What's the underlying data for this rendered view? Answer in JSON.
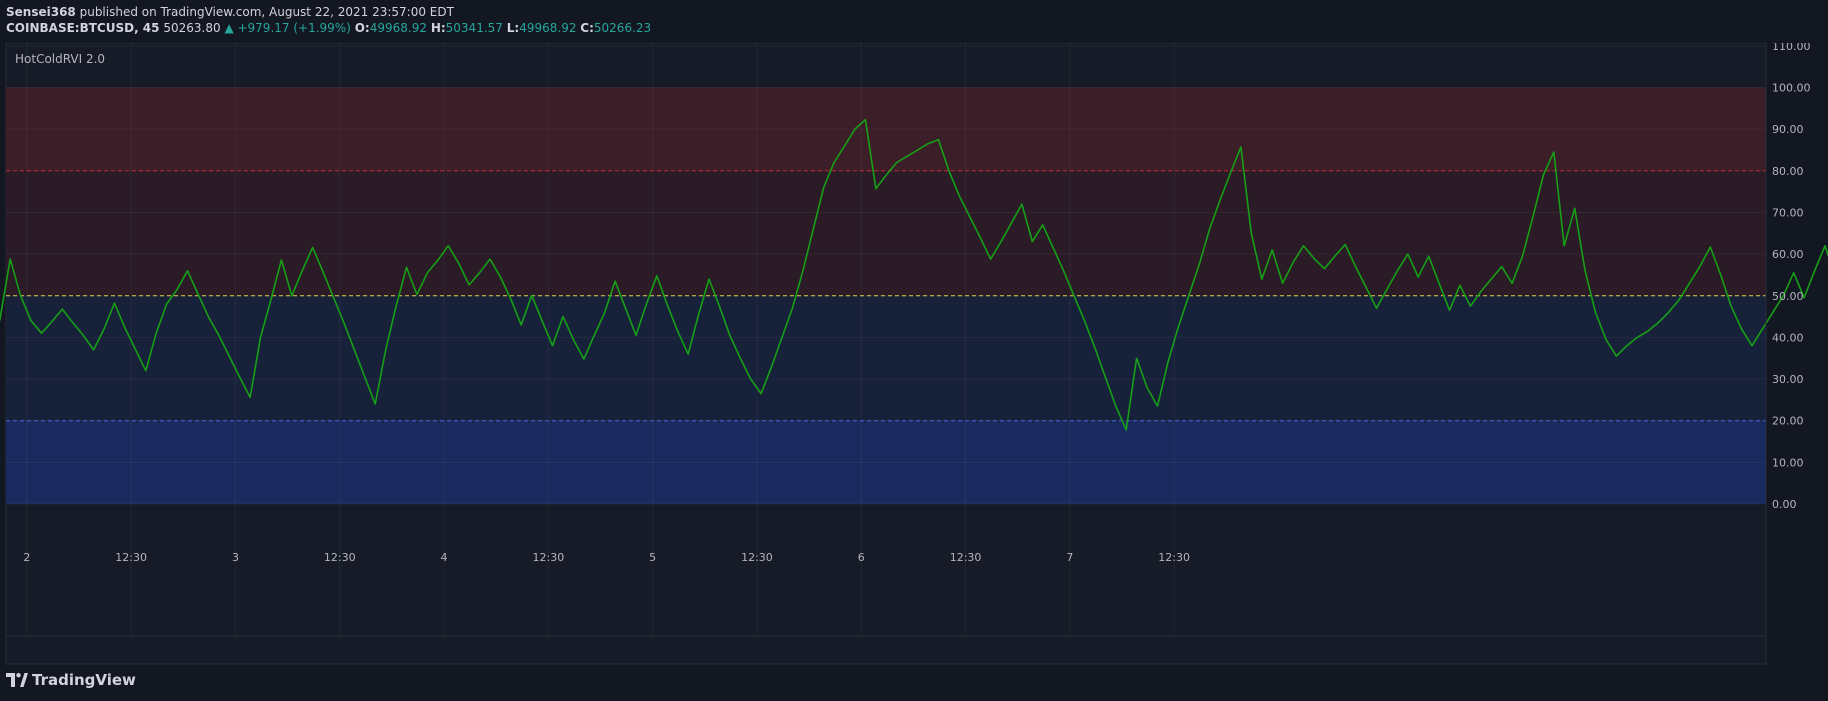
{
  "header": {
    "author": "Sensei368",
    "published": " published on TradingView.com, August 22, 2021 23:57:00 EDT",
    "symbol": "COINBASE:BTCUSD, 45",
    "last": "50263.80",
    "change": "▲ +979.17 (+1.99%)",
    "o_label": "O:",
    "o_val": "49968.92",
    "h_label": "H:",
    "h_val": "50341.57",
    "l_label": "L:",
    "l_val": "49968.92",
    "c_label": "C:",
    "c_val": "50266.23"
  },
  "brand": {
    "name": "TradingView",
    "icon": "tradingview-logo-icon"
  },
  "colors": {
    "background": "#131722",
    "line": "#15a015",
    "hot_zone": "#3b1e27",
    "warm_zone": "#2a1b26",
    "cool_zone": "#18213a",
    "cold_zone": "#1a2a5e",
    "hot_line": "#c62828",
    "cold_line": "#3d6ad6",
    "mid_line": "#e0d24a"
  },
  "chart_data": {
    "type": "line",
    "title": "HotColdRVI 2.0",
    "ylim": [
      0,
      110
    ],
    "y_ticks": [
      "0.00",
      "10.00",
      "20.00",
      "30.00",
      "40.00",
      "50.00",
      "60.00",
      "70.00",
      "80.00",
      "90.00",
      "100.00",
      "110.00"
    ],
    "x_tick_labels": [
      "2",
      "12:30",
      "3",
      "12:30",
      "4",
      "12:30",
      "5",
      "12:30",
      "6",
      "12:30",
      "7",
      "12:30"
    ],
    "x_tick_index": [
      2,
      12,
      22,
      32,
      42,
      52,
      62,
      72,
      82,
      92,
      102,
      112
    ],
    "bands": [
      {
        "from": 80,
        "to": 100,
        "name": "hot"
      },
      {
        "from": 50,
        "to": 80,
        "name": "warm"
      },
      {
        "from": 20,
        "to": 50,
        "name": "cool"
      },
      {
        "from": 0,
        "to": 20,
        "name": "cold"
      }
    ],
    "levels": [
      {
        "value": 80,
        "style": "dashed",
        "name": "hot"
      },
      {
        "value": 50,
        "style": "dashed",
        "name": "mid"
      },
      {
        "value": 20,
        "style": "dashed",
        "name": "cold"
      }
    ],
    "grid": true,
    "series": [
      {
        "x_start": -0.6,
        "values": [
          44,
          58.8,
          50,
          44,
          41,
          43.8,
          46.8,
          43.5,
          40.5,
          37,
          42,
          48.2,
          42.3,
          37.2,
          32,
          41,
          48,
          51.5,
          56,
          50.5,
          45,
          40.5,
          35.5,
          30.5,
          25.6,
          40,
          49,
          58.6,
          50,
          56,
          61.6,
          55.7,
          49.6,
          43.5,
          37,
          30.5,
          24,
          37,
          47.5,
          56.8,
          50.3,
          55.5,
          58.5,
          62,
          57.8,
          52.6,
          55.5,
          58.8,
          54.5,
          49.2,
          43,
          50.1,
          44,
          38,
          45,
          39.5,
          34.8,
          40.5,
          46,
          53.5,
          47,
          40.5,
          48,
          54.8,
          47.8,
          41.5,
          36,
          45.5,
          54,
          47.5,
          40.5,
          35,
          30,
          26.5,
          33,
          40,
          47,
          56,
          66,
          76,
          82,
          86,
          90,
          92.3,
          75.7,
          79,
          82,
          83.5,
          85,
          86.5,
          87.5,
          80,
          74,
          69,
          64,
          58.8,
          63,
          67.5,
          72,
          63,
          67,
          61.5,
          56,
          50,
          44,
          37.5,
          30.5,
          23.5,
          17.8,
          35,
          28,
          23.5,
          34,
          42.5,
          50,
          57.5,
          66,
          73,
          79.5,
          85.7,
          65,
          54,
          61,
          53,
          58,
          62,
          59,
          56.5,
          59.5,
          62.3,
          57,
          52,
          47,
          51.5,
          56,
          60,
          54.5,
          59.5,
          53,
          46.5,
          52.5,
          47.5,
          51,
          54,
          57,
          53,
          59.5,
          69,
          79,
          84.5,
          62,
          71,
          56,
          46,
          39.5,
          35.5,
          38,
          40,
          41.5,
          43.5,
          46,
          49,
          53,
          57,
          61.7,
          55,
          47.5,
          42,
          38,
          42,
          46,
          50,
          55.5,
          49.5,
          56,
          62,
          54.5,
          46,
          51.5,
          56.9,
          49,
          57.5,
          63.5,
          69,
          73.5,
          78.5
        ]
      }
    ]
  }
}
